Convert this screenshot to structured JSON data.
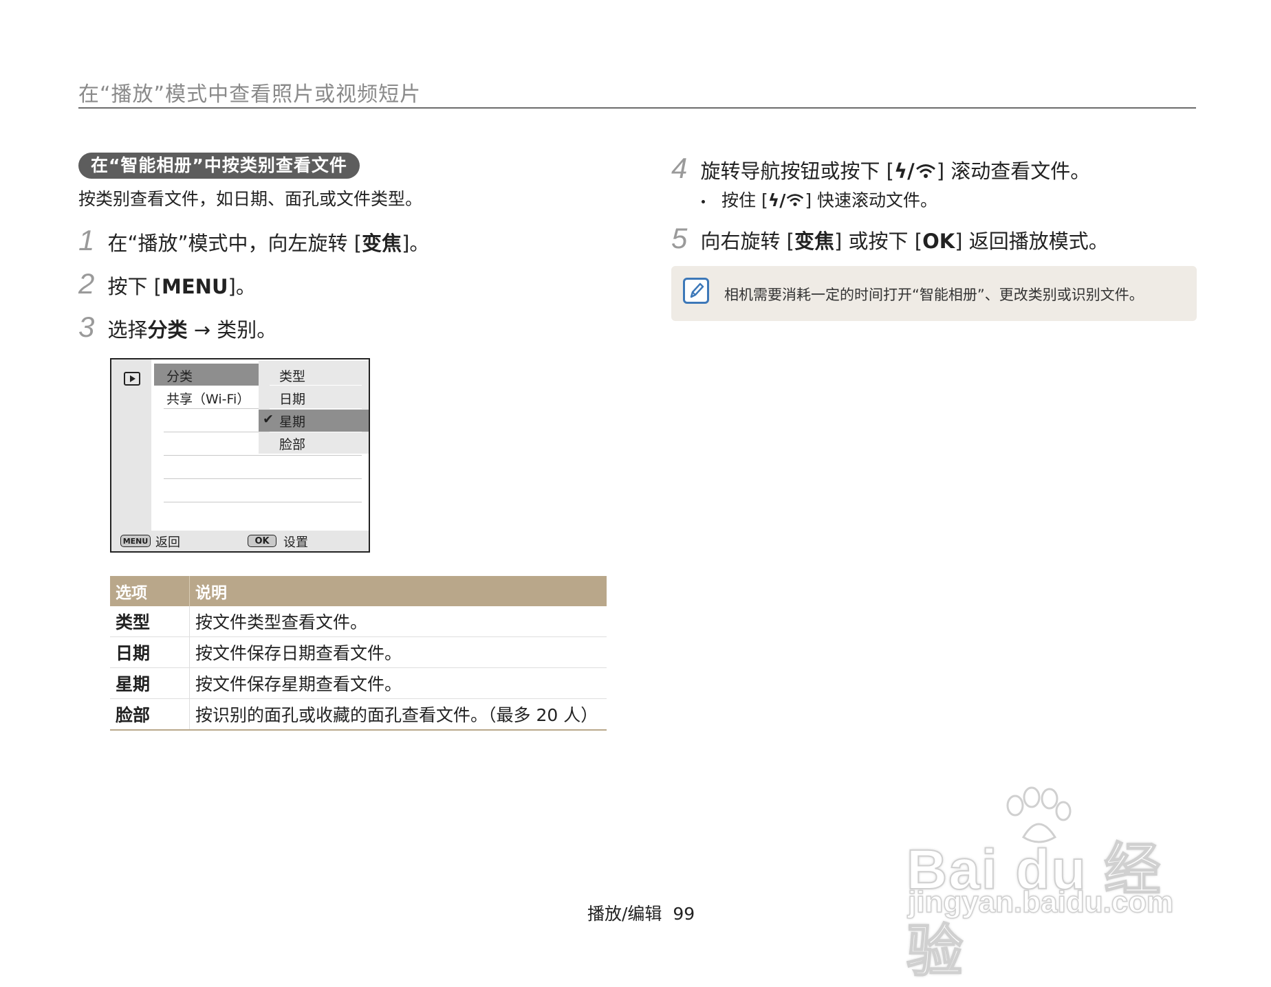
{
  "header": {
    "title": "在“播放”模式中查看照片或视频短片"
  },
  "section": {
    "pill": "在“智能相册”中按类别查看文件",
    "desc": "按类别查看文件，如日期、面孔或文件类型。"
  },
  "steps_left": [
    {
      "num": "1",
      "pre": "在“播放”模式中，向左旋转 [",
      "bold": "变焦",
      "post": "]。"
    },
    {
      "num": "2",
      "pre": "按下 [",
      "bold": "MENU",
      "post": "]。"
    },
    {
      "num": "3",
      "pre": "选择",
      "bold": "分类",
      "post": " → 类别。"
    }
  ],
  "camera_screen": {
    "categories": [
      "分类",
      "共享（Wi-Fi）"
    ],
    "submenu": [
      "类型",
      "日期",
      "星期",
      "脸部"
    ],
    "selected_submenu": "星期",
    "check_glyph": "✔",
    "back_btn": "MENU",
    "back_label": "返回",
    "ok_btn": "OK",
    "ok_label": "设置"
  },
  "table": {
    "headers": [
      "选项",
      "说明"
    ],
    "rows": [
      {
        "key": "类型",
        "desc": "按文件类型查看文件。"
      },
      {
        "key": "日期",
        "desc": "按文件保存日期查看文件。"
      },
      {
        "key": "星期",
        "desc": "按文件保存星期查看文件。"
      },
      {
        "key": "脸部",
        "desc": "按识别的面孔或收藏的面孔查看文件。（最多 20 人）"
      }
    ]
  },
  "steps_right": {
    "step4": {
      "num": "4",
      "pre": "旋转导航按钮或按下 [",
      "sym": "ϟ/",
      "post": "] 滚动查看文件。"
    },
    "bullet": {
      "pre": "按住 [",
      "sym": "ϟ/",
      "post": "] 快速滚动文件。"
    },
    "step5": {
      "num": "5",
      "pre": "向右旋转 [",
      "bold1": "变焦",
      "mid": "] 或按下 [",
      "bold2": "OK",
      "post": "] 返回播放模式。"
    }
  },
  "note": {
    "text": "相机需要消耗一定的时间打开“智能相册”、更改类别或识别文件。"
  },
  "watermark": {
    "line1": "Bai du 经验",
    "line2": "jingyan.baidu.com"
  },
  "footer": {
    "text": "播放/编辑  99"
  }
}
